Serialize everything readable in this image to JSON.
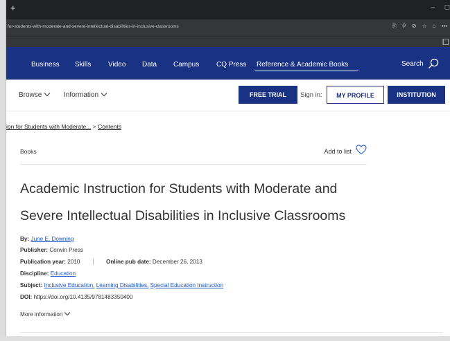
{
  "browser": {
    "new_tab": "+",
    "minimize": "–",
    "url": "for-students-with-moderate-and-severe-intellectual-disabilities-in-inclusive-classrooms"
  },
  "site_nav": {
    "items": [
      "Business",
      "Skills",
      "Video",
      "Data",
      "Campus",
      "CQ Press",
      "Reference & Academic Books"
    ],
    "search_label": "Search",
    "accent_color": "#1a3283"
  },
  "sub_nav": {
    "browse": "Browse",
    "information": "Information",
    "free_trial": "FREE TRIAL",
    "sign_in": "Sign in:",
    "my_profile": "MY PROFILE",
    "institution": "INSTITUTION"
  },
  "breadcrumb": {
    "parent": "ion for Students with Moderate...",
    "separator": ">",
    "current": "Contents"
  },
  "section": {
    "label": "Books",
    "add_to_list": "Add to list"
  },
  "book": {
    "title_line1": "Academic Instruction for Students with Moderate and",
    "title_line2": "Severe Intellectual Disabilities in Inclusive Classrooms",
    "by_label": "By:",
    "author": "June E. Downing",
    "publisher_label": "Publisher:",
    "publisher": "Corwin Press",
    "pub_year_label": "Publication year:",
    "pub_year": "2010",
    "online_date_label": "Online pub date:",
    "online_date": "December 26, 2013",
    "discipline_label": "Discipline:",
    "discipline": "Education",
    "subject_label": "Subject:",
    "subjects": [
      "Inclusive Education,",
      "Learning Disabilities,",
      "Special Education Instruction"
    ],
    "doi_label": "DOI:",
    "doi": "https://doi.org/10.4135/9781483350400",
    "more_info": "More information"
  }
}
